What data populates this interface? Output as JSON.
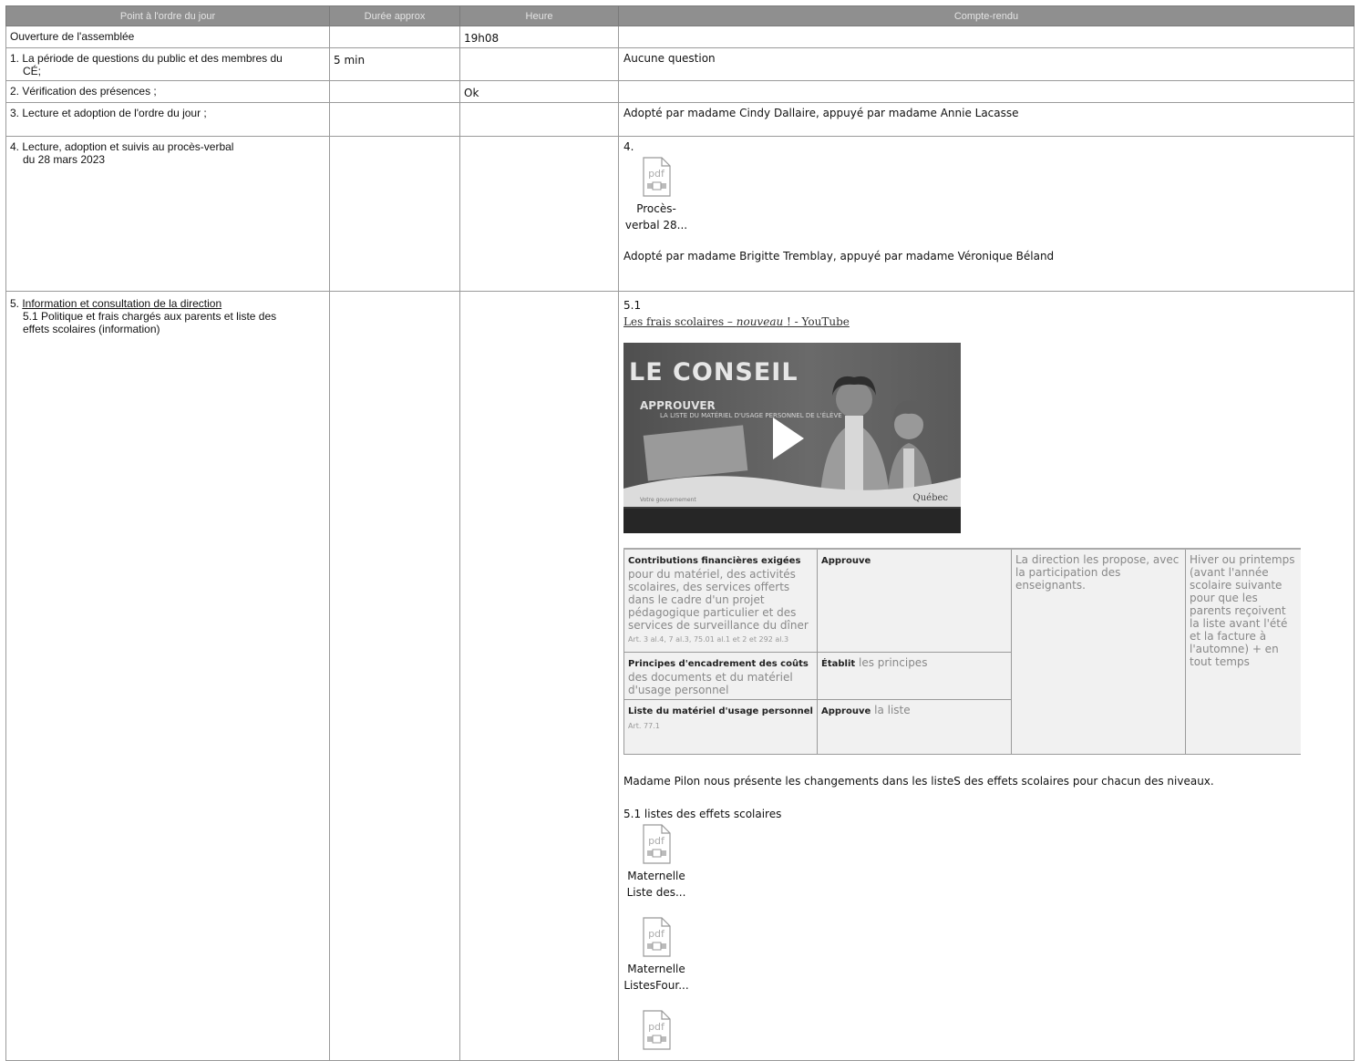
{
  "headers": [
    "Point à l'ordre du jour",
    "Durée approx",
    "Heure",
    "Compte-rendu"
  ],
  "rows": [
    {
      "point": "Ouverture de l'assemblée",
      "duree": "",
      "heure": "19h08",
      "compte": ""
    },
    {
      "point_line1": "1. La période de questions du public et des membres du",
      "point_line2": "CÉ;",
      "duree": "5 min",
      "heure": "",
      "compte": "Aucune question"
    },
    {
      "point": "2. Vérification des présences ;",
      "duree": "",
      "heure": "Ok",
      "compte": ""
    },
    {
      "point": "3. Lecture et adoption de l'ordre du jour ;",
      "duree": "",
      "heure": "",
      "compte": "Adopté par madame Cindy Dallaire, appuyé par madame Annie Lacasse"
    }
  ],
  "row4": {
    "point_line1": "4. Lecture, adoption et suivis au procès-verbal",
    "point_line2": "du 28 mars 2023",
    "number": "4.",
    "attachment_label_1": "Procès-",
    "attachment_label_2": "verbal 28...",
    "result": "Adopté par madame Brigitte Tremblay, appuyé par madame Véronique Béland"
  },
  "row5": {
    "point_prefix": "5. ",
    "point_title": "Information et consultation de la direction",
    "sub_line1": "5.1 Politique et frais chargés aux parents et liste des",
    "sub_line2": "effets scolaires (information)",
    "number": "5.1",
    "link_prefix": "Les frais scolaires – ",
    "link_italic": "nouveau",
    "link_suffix": " ! - YouTube",
    "video": {
      "title": "LE CONSEIL",
      "subtitle": "APPROUVER",
      "subtitle2": "LA LISTE DU MATÉRIEL D'USAGE PERSONNEL DE L'ÉLÈVE",
      "brand": "Québec",
      "gov": "Votre gouvernement"
    },
    "inner_table": {
      "r1c1_bold": "Contributions financières exigées",
      "r1c1_text": "pour du matériel, des activités scolaires, des services offerts dans le cadre d'un projet pédagogique particulier et des services de surveillance du dîner",
      "r1c1_ref": "Art. 3 al.4, 7 al.3, 75.01 al.1 et 2 et 292 al.3",
      "r1c2_bold": "Approuve",
      "r1c3": "La direction les propose, avec la participation des enseignants.",
      "r1c4": "Hiver ou printemps (avant l'année scolaire suivante pour que les parents reçoivent la liste avant l'été et la facture à l'automne) + en tout temps",
      "r2c1_bold": "Principes d'encadrement des coûts",
      "r2c1_text": "des documents et du matériel d'usage personnel",
      "r2c2_bold": "Établit",
      "r2c2_text": "les principes",
      "r3c1_bold": "Liste du matériel d'usage personnel",
      "r3c1_ref": "Art. 77.1",
      "r3c2_bold": "Approuve",
      "r3c2_text": "la liste"
    },
    "paragraph": "Madame Pilon nous présente les changements dans les listeS des effets scolaires pour chacun des niveaux.",
    "list_title": "5.1 listes des effets scolaires",
    "att1_l1": "Maternelle",
    "att1_l2": "Liste des...",
    "att2_l1": "Maternelle",
    "att2_l2": "ListesFour...",
    "pdf_word": "pdf"
  }
}
